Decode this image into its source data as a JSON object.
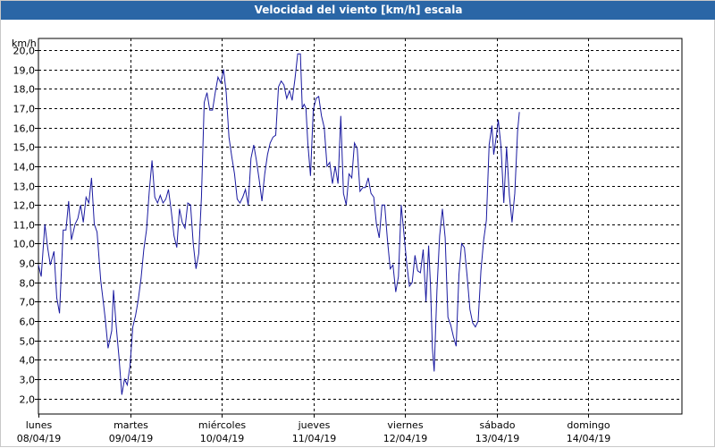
{
  "window": {
    "title": "Velocidad del viento [km/h] escala"
  },
  "colors": {
    "title_bar": "#2a66a6",
    "series": "#1a1aa0",
    "grid": "#000000",
    "background": "#ffffff"
  },
  "chart_data": {
    "type": "line",
    "title": "Velocidad del viento [km/h] escala",
    "ylabel": "km/h",
    "xlabel": "",
    "ylim": [
      1.2,
      20.6
    ],
    "xlim": [
      0,
      7.05
    ],
    "grid": true,
    "grid_style": "dashed",
    "yticks": [
      "2,0",
      "3,0",
      "4,0",
      "5,0",
      "6,0",
      "7,0",
      "8,0",
      "9,0",
      "10,0",
      "11,0",
      "12,0",
      "13,0",
      "14,0",
      "15,0",
      "16,0",
      "17,0",
      "18,0",
      "19,0",
      "20,0"
    ],
    "x_categories": [
      {
        "day": "lunes",
        "date": "08/04/19"
      },
      {
        "day": "martes",
        "date": "09/04/19"
      },
      {
        "day": "miércoles",
        "date": "10/04/19"
      },
      {
        "day": "jueves",
        "date": "11/04/19"
      },
      {
        "day": "viernes",
        "date": "12/04/19"
      },
      {
        "day": "sábado",
        "date": "13/04/19"
      },
      {
        "day": "domingo",
        "date": "14/04/19"
      }
    ],
    "series": [
      {
        "color": "#1a1aa0",
        "points": [
          [
            0.0,
            8.9
          ],
          [
            0.03,
            8.3
          ],
          [
            0.07,
            11.0
          ],
          [
            0.1,
            9.8
          ],
          [
            0.13,
            8.9
          ],
          [
            0.17,
            9.6
          ],
          [
            0.2,
            7.2
          ],
          [
            0.23,
            6.4
          ],
          [
            0.27,
            10.7
          ],
          [
            0.3,
            10.7
          ],
          [
            0.33,
            12.2
          ],
          [
            0.36,
            10.2
          ],
          [
            0.4,
            11.0
          ],
          [
            0.43,
            11.3
          ],
          [
            0.46,
            12.0
          ],
          [
            0.49,
            11.1
          ],
          [
            0.52,
            12.4
          ],
          [
            0.55,
            12.1
          ],
          [
            0.58,
            13.4
          ],
          [
            0.61,
            11.0
          ],
          [
            0.64,
            10.6
          ],
          [
            0.68,
            8.1
          ],
          [
            0.71,
            6.9
          ],
          [
            0.73,
            6.1
          ],
          [
            0.76,
            4.6
          ],
          [
            0.8,
            5.5
          ],
          [
            0.82,
            7.6
          ],
          [
            0.85,
            5.7
          ],
          [
            0.88,
            4.1
          ],
          [
            0.91,
            2.2
          ],
          [
            0.94,
            3.0
          ],
          [
            0.97,
            2.7
          ],
          [
            1.0,
            3.7
          ],
          [
            1.03,
            5.7
          ],
          [
            1.06,
            6.3
          ],
          [
            1.09,
            7.1
          ],
          [
            1.12,
            8.2
          ],
          [
            1.15,
            9.7
          ],
          [
            1.18,
            10.7
          ],
          [
            1.21,
            12.7
          ],
          [
            1.24,
            14.3
          ],
          [
            1.27,
            12.4
          ],
          [
            1.3,
            12.1
          ],
          [
            1.33,
            12.5
          ],
          [
            1.36,
            12.1
          ],
          [
            1.39,
            12.3
          ],
          [
            1.42,
            12.8
          ],
          [
            1.45,
            11.7
          ],
          [
            1.48,
            10.4
          ],
          [
            1.51,
            9.8
          ],
          [
            1.54,
            11.8
          ],
          [
            1.57,
            11.1
          ],
          [
            1.6,
            10.8
          ],
          [
            1.63,
            12.1
          ],
          [
            1.66,
            12.0
          ],
          [
            1.69,
            10.0
          ],
          [
            1.72,
            8.7
          ],
          [
            1.75,
            9.5
          ],
          [
            1.78,
            12.4
          ],
          [
            1.81,
            17.3
          ],
          [
            1.84,
            17.8
          ],
          [
            1.87,
            16.9
          ],
          [
            1.9,
            16.9
          ],
          [
            1.93,
            17.8
          ],
          [
            1.96,
            18.6
          ],
          [
            1.99,
            18.3
          ],
          [
            2.02,
            19.0
          ],
          [
            2.05,
            17.8
          ],
          [
            2.08,
            15.5
          ],
          [
            2.11,
            14.5
          ],
          [
            2.14,
            13.6
          ],
          [
            2.17,
            12.3
          ],
          [
            2.2,
            12.1
          ],
          [
            2.23,
            12.4
          ],
          [
            2.26,
            12.8
          ],
          [
            2.29,
            12.0
          ],
          [
            2.32,
            14.4
          ],
          [
            2.35,
            15.1
          ],
          [
            2.38,
            14.3
          ],
          [
            2.41,
            13.3
          ],
          [
            2.44,
            12.2
          ],
          [
            2.47,
            13.6
          ],
          [
            2.5,
            14.6
          ],
          [
            2.53,
            15.2
          ],
          [
            2.56,
            15.5
          ],
          [
            2.59,
            15.6
          ],
          [
            2.62,
            18.1
          ],
          [
            2.65,
            18.4
          ],
          [
            2.68,
            18.2
          ],
          [
            2.71,
            17.5
          ],
          [
            2.74,
            17.9
          ],
          [
            2.77,
            17.4
          ],
          [
            2.8,
            18.5
          ],
          [
            2.83,
            19.8
          ],
          [
            2.86,
            19.8
          ],
          [
            2.88,
            17.0
          ],
          [
            2.9,
            17.2
          ],
          [
            2.92,
            17.0
          ],
          [
            2.94,
            15.2
          ],
          [
            2.97,
            13.5
          ],
          [
            3.0,
            16.9
          ],
          [
            3.03,
            17.5
          ],
          [
            3.06,
            17.6
          ],
          [
            3.09,
            16.6
          ],
          [
            3.12,
            16.0
          ],
          [
            3.15,
            14.0
          ],
          [
            3.18,
            14.2
          ],
          [
            3.21,
            13.1
          ],
          [
            3.24,
            14.0
          ],
          [
            3.27,
            13.1
          ],
          [
            3.3,
            16.6
          ],
          [
            3.33,
            12.6
          ],
          [
            3.36,
            12.0
          ],
          [
            3.39,
            13.6
          ],
          [
            3.42,
            13.4
          ],
          [
            3.45,
            15.2
          ],
          [
            3.48,
            14.9
          ],
          [
            3.51,
            12.7
          ],
          [
            3.54,
            12.9
          ],
          [
            3.57,
            12.9
          ],
          [
            3.6,
            13.4
          ],
          [
            3.63,
            12.6
          ],
          [
            3.66,
            12.4
          ],
          [
            3.69,
            11.0
          ],
          [
            3.72,
            10.3
          ],
          [
            3.75,
            12.0
          ],
          [
            3.78,
            12.0
          ],
          [
            3.81,
            10.2
          ],
          [
            3.84,
            8.7
          ],
          [
            3.87,
            8.9
          ],
          [
            3.9,
            7.5
          ],
          [
            3.93,
            8.3
          ],
          [
            3.96,
            12.0
          ],
          [
            3.99,
            10.5
          ],
          [
            4.02,
            9.0
          ],
          [
            4.05,
            7.8
          ],
          [
            4.08,
            8.0
          ],
          [
            4.11,
            9.4
          ],
          [
            4.14,
            8.6
          ],
          [
            4.17,
            8.5
          ],
          [
            4.2,
            9.7
          ],
          [
            4.23,
            7.0
          ],
          [
            4.26,
            9.9
          ],
          [
            4.28,
            7.8
          ],
          [
            4.3,
            4.6
          ],
          [
            4.32,
            3.4
          ],
          [
            4.35,
            7.6
          ],
          [
            4.38,
            10.4
          ],
          [
            4.41,
            11.8
          ],
          [
            4.44,
            10.3
          ],
          [
            4.47,
            6.2
          ],
          [
            4.5,
            5.8
          ],
          [
            4.53,
            5.2
          ],
          [
            4.56,
            4.7
          ],
          [
            4.59,
            8.4
          ],
          [
            4.62,
            10.0
          ],
          [
            4.65,
            9.8
          ],
          [
            4.68,
            8.3
          ],
          [
            4.71,
            6.6
          ],
          [
            4.74,
            5.9
          ],
          [
            4.77,
            5.7
          ],
          [
            4.8,
            6.0
          ],
          [
            4.83,
            8.6
          ],
          [
            4.86,
            10.2
          ],
          [
            4.89,
            11.2
          ],
          [
            4.92,
            15.1
          ],
          [
            4.95,
            16.1
          ],
          [
            4.97,
            14.6
          ],
          [
            5.0,
            15.6
          ],
          [
            5.02,
            16.4
          ],
          [
            5.05,
            15.0
          ],
          [
            5.08,
            12.1
          ],
          [
            5.11,
            15.0
          ],
          [
            5.14,
            12.5
          ],
          [
            5.17,
            11.1
          ],
          [
            5.2,
            12.6
          ],
          [
            5.23,
            15.8
          ],
          [
            5.25,
            16.8
          ]
        ]
      }
    ]
  }
}
